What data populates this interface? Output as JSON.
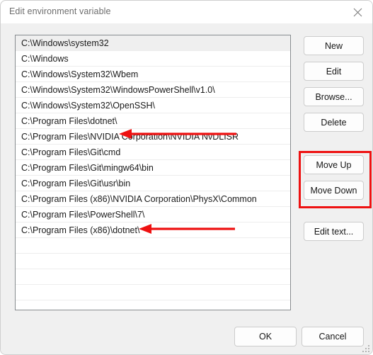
{
  "window": {
    "title": "Edit environment variable",
    "close_icon": "close-icon"
  },
  "list": {
    "items": [
      "C:\\Windows\\system32",
      "C:\\Windows",
      "C:\\Windows\\System32\\Wbem",
      "C:\\Windows\\System32\\WindowsPowerShell\\v1.0\\",
      "C:\\Windows\\System32\\OpenSSH\\",
      "C:\\Program Files\\dotnet\\",
      "C:\\Program Files\\NVIDIA Corporation\\NVIDIA NvDLISR",
      "C:\\Program Files\\Git\\cmd",
      "C:\\Program Files\\Git\\mingw64\\bin",
      "C:\\Program Files\\Git\\usr\\bin",
      "C:\\Program Files (x86)\\NVIDIA Corporation\\PhysX\\Common",
      "C:\\Program Files\\PowerShell\\7\\",
      "C:\\Program Files (x86)\\dotnet\\"
    ],
    "selected_index": 0,
    "empty_row_count": 4
  },
  "side_buttons": [
    {
      "id": "new",
      "label": "New"
    },
    {
      "id": "edit",
      "label": "Edit"
    },
    {
      "id": "browse",
      "label": "Browse..."
    },
    {
      "id": "delete",
      "label": "Delete"
    },
    {
      "id": "moveup",
      "label": "Move Up"
    },
    {
      "id": "movedown",
      "label": "Move Down"
    },
    {
      "id": "edittext",
      "label": "Edit text..."
    }
  ],
  "bottom_buttons": {
    "ok": "OK",
    "cancel": "Cancel"
  },
  "annotations": {
    "highlight_color": "#ee1111",
    "arrow_color": "#ee1111",
    "arrows": [
      {
        "name": "arrow-dotnet-x64",
        "points_to_row": 5
      },
      {
        "name": "arrow-dotnet-x86",
        "points_to_row": 12
      }
    ],
    "highlight_box": {
      "name": "move-buttons-highlight",
      "targets": [
        "Move Up",
        "Move Down"
      ]
    }
  }
}
